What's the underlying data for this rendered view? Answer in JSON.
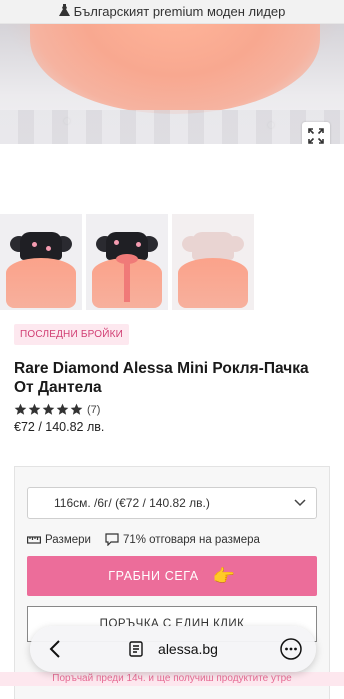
{
  "promo": {
    "text": "Българският premium моден лидер",
    "icon": "dress-icon"
  },
  "gallery": {
    "expand_icon": "expand-icon",
    "thumbnails": [
      "front-view",
      "back-view",
      "light-variant"
    ]
  },
  "product": {
    "badge": "ПОСЛЕДНИ БРОЙКИ",
    "title": "Rare Diamond Alessa Mini Рокля-Пачка От Дантела",
    "rating_stars": 5,
    "review_count": "(7)",
    "price": "€72 / 140.82 лв."
  },
  "buybox": {
    "size_select": "116см. /6г/ (€72 / 140.82 лв.)",
    "sizes_link": "Размери",
    "fit_text": "71% отговаря на размера",
    "add_to_cart": "ГРАБНИ СЕГА",
    "one_click": "ПОРЪЧКА С ЕДИН КЛИК",
    "ship_note": "Поръчай преди 14ч. и ще получиш продуктите утре"
  },
  "browser": {
    "url": "alessa.bg"
  },
  "colors": {
    "accent": "#ec6d9a",
    "badge_bg": "#fde8ef",
    "badge_text": "#d13e73"
  }
}
